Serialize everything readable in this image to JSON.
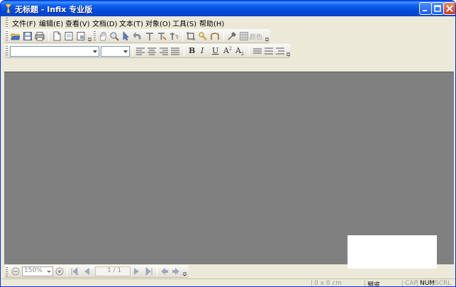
{
  "window": {
    "title": "无标题 - Infix 专业版"
  },
  "menu": {
    "items": [
      "文件(F)",
      "编辑(E)",
      "查看(V)",
      "文档(D)",
      "文本(T)",
      "对象(O)",
      "工具(S)",
      "帮助(H)"
    ]
  },
  "toolbar_main": {
    "icons": [
      "open-icon",
      "save-icon",
      "print-icon",
      "new-page-icon",
      "page-view-icon",
      "page-properties-icon",
      "hand-icon",
      "zoom-icon",
      "select-arrow-icon",
      "undo-icon",
      "text-tool-icon",
      "text-edit-icon",
      "text-flow-icon",
      "crop-icon",
      "link-icon",
      "shape-icon",
      "eyedropper-icon",
      "grid-icon"
    ],
    "color_label": "颜色"
  },
  "toolbar_format": {
    "font_name": "",
    "font_size": "",
    "bold_label": "B",
    "italic_label": "I",
    "underline_label": "U",
    "superscript_label": "A",
    "subscript_label": "A"
  },
  "navbar": {
    "zoom_value": "150%",
    "page_value": "1 / 1"
  },
  "statusbar": {
    "coords": "0 x 0 cm",
    "mode": "预览",
    "cap": "CAP",
    "num": "NUM",
    "scrl": "SCRL"
  },
  "colors": {
    "titlebar": "#0a5ae8",
    "chrome": "#ece9d8",
    "workspace": "#808080"
  }
}
